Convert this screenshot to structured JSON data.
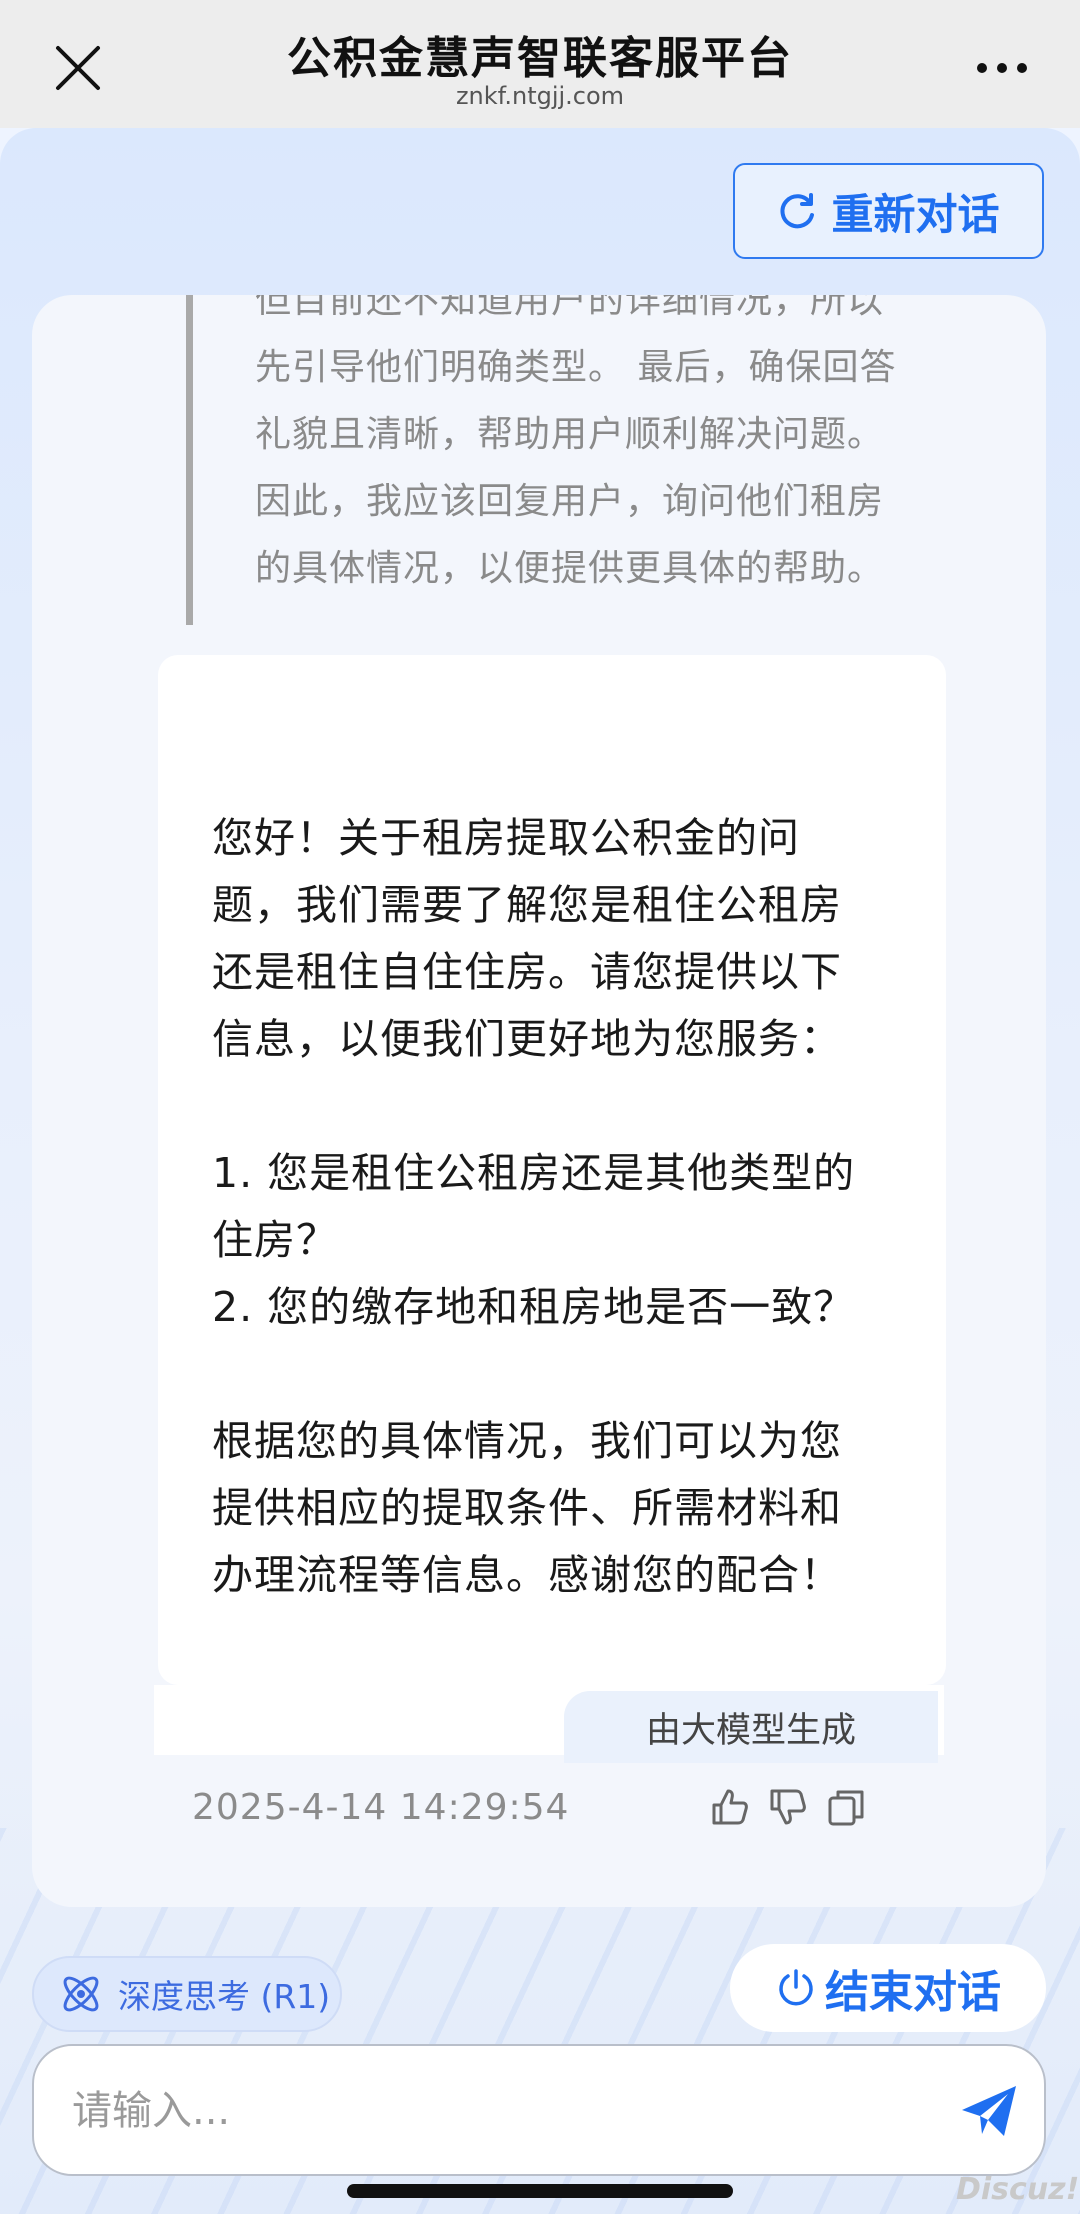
{
  "nav": {
    "title": "公积金慧声智联客服平台",
    "domain": "znkf.ntgjj.com",
    "close_icon": "close-icon",
    "more_icon": "more-icon"
  },
  "restart_button": {
    "label": "重新对话",
    "icon": "refresh-icon"
  },
  "thinking": {
    "lines": [
      "但目前还不知道用户的详细情况，所以",
      "先引导他们明确类型。 最后，确保回答",
      "礼貌且清晰，帮助用户顺利解决问题。",
      "因此，我应该回复用户，询问他们租房",
      "的具体情况，以便提供更具体的帮助。"
    ]
  },
  "answer": {
    "greeting_lines": [
      "您好！关于租房提取公积金的问",
      "题，我们需要了解您是租住公租房",
      "还是租住自住住房。请您提供以下",
      "信息，以便我们更好地为您服务："
    ],
    "question_lines": [
      "1. 您是租住公租房还是其他类型的",
      "住房？",
      "2. 您的缴存地和租房地是否一致？"
    ],
    "closing_lines": [
      "根据您的具体情况，我们可以为您",
      "提供相应的提取条件、所需材料和",
      "办理流程等信息。感谢您的配合！"
    ]
  },
  "generated_badge": "由大模型生成",
  "timestamp": "2025-4-14 14:29:54",
  "actions": {
    "like_icon": "thumbs-up-icon",
    "dislike_icon": "thumbs-down-icon",
    "copy_icon": "copy-icon"
  },
  "deep_think": {
    "label": "深度思考 (R1)",
    "icon": "atom-icon"
  },
  "end_button": {
    "label": "结束对话",
    "icon": "power-icon"
  },
  "input": {
    "placeholder": "请输入...",
    "value": ""
  },
  "send_icon": "send-icon",
  "watermark": "Discuz!",
  "colors": {
    "accent": "#1f6ff0",
    "background": "#e3ecfb",
    "card": "#f3f6fc"
  }
}
